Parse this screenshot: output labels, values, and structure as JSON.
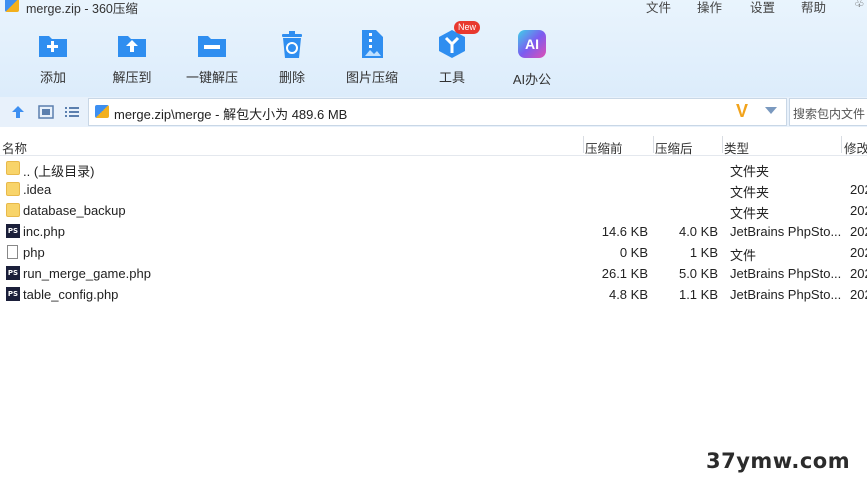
{
  "window": {
    "title": "merge.zip - 360压缩"
  },
  "menu": [
    "文件",
    "操作",
    "设置",
    "帮助"
  ],
  "toolbar": [
    {
      "label": "添加",
      "icon": "add-icon"
    },
    {
      "label": "解压到",
      "icon": "extract-to-icon"
    },
    {
      "label": "一键解压",
      "icon": "one-click-extract-icon"
    },
    {
      "label": "删除",
      "icon": "delete-icon"
    },
    {
      "label": "图片压缩",
      "icon": "image-compress-icon"
    },
    {
      "label": "工具",
      "icon": "tools-icon",
      "badge": "New"
    },
    {
      "label": "AI办公",
      "icon": "ai-office-icon"
    }
  ],
  "ai_icon_text": "AI",
  "path": {
    "text": "merge.zip\\merge - 解包大小为 489.6 MB"
  },
  "search": {
    "placeholder": "搜索包内文件"
  },
  "columns": {
    "name": "名称",
    "before": "压缩前",
    "after": "压缩后",
    "type": "类型",
    "modified": "修改"
  },
  "files": [
    {
      "name": ".. (上级目录)",
      "before": "",
      "after": "",
      "type": "文件夹",
      "modified": "",
      "icon": "folder-icon"
    },
    {
      "name": ".idea",
      "before": "",
      "after": "",
      "type": "文件夹",
      "modified": "202",
      "icon": "folder-icon"
    },
    {
      "name": "database_backup",
      "before": "",
      "after": "",
      "type": "文件夹",
      "modified": "202",
      "icon": "folder-icon"
    },
    {
      "name": "inc.php",
      "before": "14.6 KB",
      "after": "4.0 KB",
      "type": "JetBrains PhpSto...",
      "modified": "202",
      "icon": "phpstorm-file-icon"
    },
    {
      "name": "php",
      "before": "0 KB",
      "after": "1 KB",
      "type": "文件",
      "modified": "202",
      "icon": "blank-file-icon"
    },
    {
      "name": "run_merge_game.php",
      "before": "26.1 KB",
      "after": "5.0 KB",
      "type": "JetBrains PhpSto...",
      "modified": "202",
      "icon": "phpstorm-file-icon"
    },
    {
      "name": "table_config.php",
      "before": "4.8 KB",
      "after": "1.1 KB",
      "type": "JetBrains PhpSto...",
      "modified": "202",
      "icon": "phpstorm-file-icon"
    }
  ],
  "ps_icon_text": "PS",
  "watermark": "37ymw.com",
  "colors": {
    "accent": "#2f8ef0",
    "toolbar_bg": "#e3effb",
    "folder": "#f8d46a",
    "new_badge": "#e8392f",
    "dropdown_v": "#f2a31b"
  }
}
